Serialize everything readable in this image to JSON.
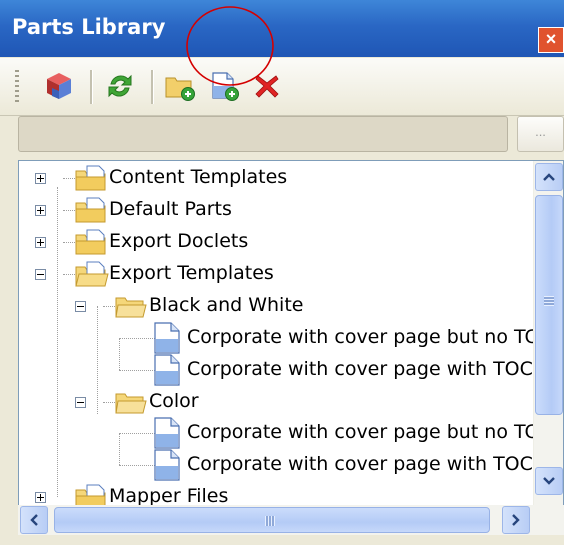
{
  "window": {
    "title": "Parts Library",
    "close_glyph": "×"
  },
  "toolbar": {
    "buttons": [
      {
        "name": "parts-cube-icon"
      },
      {
        "name": "refresh-icon"
      },
      {
        "name": "new-folder-icon"
      },
      {
        "name": "new-part-icon"
      },
      {
        "name": "delete-icon"
      }
    ]
  },
  "path": {
    "value": "",
    "browse_label": "..."
  },
  "tree": {
    "items": [
      {
        "label": "Content Templates",
        "type": "folder",
        "expander": "plus",
        "level": 0
      },
      {
        "label": "Default Parts",
        "type": "folder",
        "expander": "plus",
        "level": 0
      },
      {
        "label": "Export Doclets",
        "type": "folder",
        "expander": "plus",
        "level": 0
      },
      {
        "label": "Export Templates",
        "type": "folder",
        "expander": "minus",
        "level": 0
      },
      {
        "label": "Black and White",
        "type": "folder",
        "expander": "minus",
        "level": 1
      },
      {
        "label": "Corporate with cover page but no TC",
        "type": "document",
        "level": 2
      },
      {
        "label": "Corporate with cover page with TOC",
        "type": "document",
        "level": 2
      },
      {
        "label": "Color",
        "type": "folder",
        "expander": "minus",
        "level": 1
      },
      {
        "label": "Corporate with cover page but no TC",
        "type": "document",
        "level": 2
      },
      {
        "label": "Corporate with cover page with TOC",
        "type": "document",
        "level": 2
      },
      {
        "label": "Mapper Files",
        "type": "folder",
        "expander": "plus",
        "level": 0
      }
    ]
  },
  "colors": {
    "title_bar": "#2a67c4",
    "annotation": "#d40000",
    "close_button": "#e0532e"
  }
}
